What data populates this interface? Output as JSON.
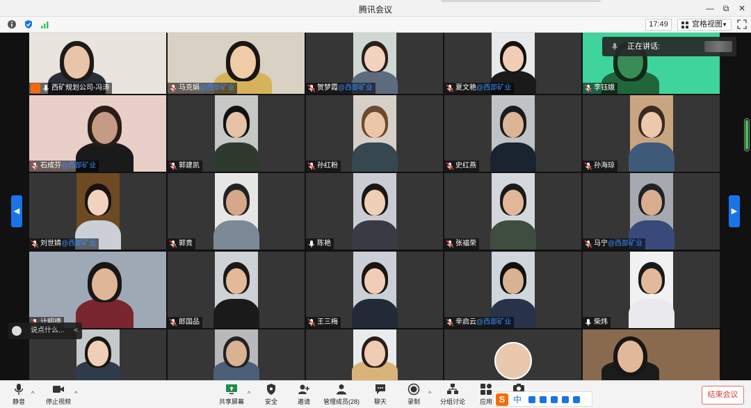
{
  "window": {
    "title": "腾讯会议",
    "minimize_glyph": "—",
    "restore_glyph": "⧉",
    "close_glyph": "✕"
  },
  "infobar": {
    "icons": [
      "info-icon",
      "shield-icon",
      "signal-icon"
    ],
    "clock": "17:49",
    "view_label": "宫格视图",
    "view_caret": "▼"
  },
  "speaking": {
    "label": "正在讲话:"
  },
  "chat": {
    "placeholder": "说点什么...",
    "collapse_glyph": "<"
  },
  "nav": {
    "left_glyph": "◀",
    "right_glyph": "▶"
  },
  "colors": {
    "org_text": "#3b8cff",
    "accent_blue": "#1a73e8",
    "end_red": "#d63a3a",
    "host_badge": "#ff6a00",
    "speaker_green": "#3bc35a"
  },
  "participants": [
    {
      "name": "西矿规划公司-冯涛",
      "org": "",
      "host": true,
      "mic": "on"
    },
    {
      "name": "马克娟",
      "org": "@西部矿业",
      "mic": "muted"
    },
    {
      "name": "贺梦霞",
      "org": "@西部矿业",
      "mic": "muted"
    },
    {
      "name": "夏文艳",
      "org": "@西部矿业",
      "mic": "muted"
    },
    {
      "name": "李钰娥",
      "org": "",
      "mic": "muted"
    },
    {
      "name": "石成芬",
      "org": "@西部矿业",
      "mic": "muted"
    },
    {
      "name": "郭建凯",
      "org": "",
      "mic": "muted"
    },
    {
      "name": "孙红粉",
      "org": "",
      "mic": "muted"
    },
    {
      "name": "史红燕",
      "org": "",
      "mic": "muted"
    },
    {
      "name": "孙海琼",
      "org": "",
      "mic": "muted"
    },
    {
      "name": "刘世婧",
      "org": "@西部矿业",
      "mic": "muted"
    },
    {
      "name": "郭贵",
      "org": "",
      "mic": "muted"
    },
    {
      "name": "陈艳",
      "org": "",
      "mic": "on"
    },
    {
      "name": "张福荣",
      "org": "",
      "mic": "muted"
    },
    {
      "name": "马宁",
      "org": "@西部矿业",
      "mic": "muted"
    },
    {
      "name": "计明德",
      "org": "",
      "mic": "muted"
    },
    {
      "name": "郎国品",
      "org": "",
      "mic": "muted"
    },
    {
      "name": "王三梅",
      "org": "",
      "mic": "muted"
    },
    {
      "name": "辛启云",
      "org": "@西部矿业",
      "mic": "muted"
    },
    {
      "name": "柴炜",
      "org": "",
      "mic": "on"
    },
    {
      "name": "",
      "org": "",
      "mic": "none"
    },
    {
      "name": "",
      "org": "",
      "mic": "none"
    },
    {
      "name": "",
      "org": "",
      "mic": "none"
    },
    {
      "name": "",
      "org": "",
      "mic": "none"
    },
    {
      "name": "",
      "org": "",
      "mic": "none"
    }
  ],
  "toolbar": {
    "mute": "静音",
    "stop_video": "停止视频",
    "share_screen": "共享屏幕",
    "security": "安全",
    "invite": "邀请",
    "members": "管理成员(28)",
    "chat": "聊天",
    "record": "录制",
    "breakout": "分组讨论",
    "apps": "应用",
    "end": "结束会议",
    "caret": "^"
  },
  "ime": {
    "logo": "S",
    "mode": "中"
  }
}
